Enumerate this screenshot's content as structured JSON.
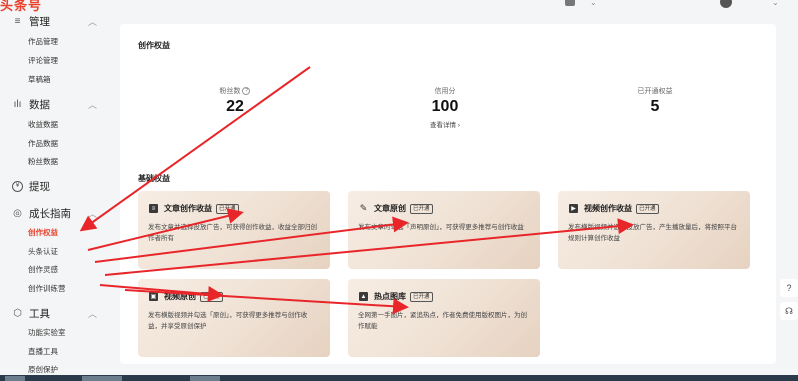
{
  "app": {
    "logo": "头条号"
  },
  "sidebar": {
    "groups": [
      {
        "icon": "list-icon",
        "title": "管理",
        "items": [
          "作品管理",
          "评论管理",
          "草稿箱"
        ]
      },
      {
        "icon": "bar-chart-icon",
        "title": "数据",
        "items": [
          "收益数据",
          "作品数据",
          "粉丝数据"
        ]
      },
      {
        "icon": "yen-icon",
        "title": "提现",
        "items": []
      },
      {
        "icon": "growth-icon",
        "title": "成长指南",
        "items": [
          "创作权益",
          "头条认证",
          "创作灵感",
          "创作训练营"
        ]
      },
      {
        "icon": "tools-icon",
        "title": "工具",
        "items": [
          "功能实验室",
          "直播工具",
          "原创保护"
        ]
      }
    ],
    "active_item": "创作权益"
  },
  "main": {
    "title": "创作权益",
    "stats": [
      {
        "label": "粉丝数",
        "value": "22",
        "link": ""
      },
      {
        "label": "信用分",
        "value": "100",
        "link": "查看详情 ›"
      },
      {
        "label": "已开通权益",
        "value": "5",
        "link": ""
      }
    ],
    "basic_title": "基础权益",
    "cards": [
      {
        "icon": "article-icon",
        "title": "文章创作收益",
        "badge": "已开通",
        "desc": "发布文章并选择投放广告，可获得创作收益，收益全部归创作者所有"
      },
      {
        "icon": "pen-icon",
        "title": "文章原创",
        "badge": "已开通",
        "desc": "发布文章时勾选「声明原创」，可获得更多推荐与创作收益"
      },
      {
        "icon": "video-icon",
        "title": "视频创作收益",
        "badge": "已开通",
        "desc": "发布横版视频并选择投放广告，产生播放量后，将按照平台规则计算创作收益"
      },
      {
        "icon": "video-original-icon",
        "title": "视频原创",
        "badge": "已开通",
        "desc": "发布横版视频并勾选「原创」，可获得更多推荐与创作收益，并享受原创保护"
      },
      {
        "icon": "image-icon",
        "title": "热点图库",
        "badge": "已开通",
        "desc": "全网第一手图片，紧追热点，作者免费使用版权图片，为创作赋能"
      }
    ]
  },
  "float": {
    "help": "?",
    "service": "☊"
  },
  "colors": {
    "accent": "#e8412c",
    "arrow": "#e8262a"
  }
}
